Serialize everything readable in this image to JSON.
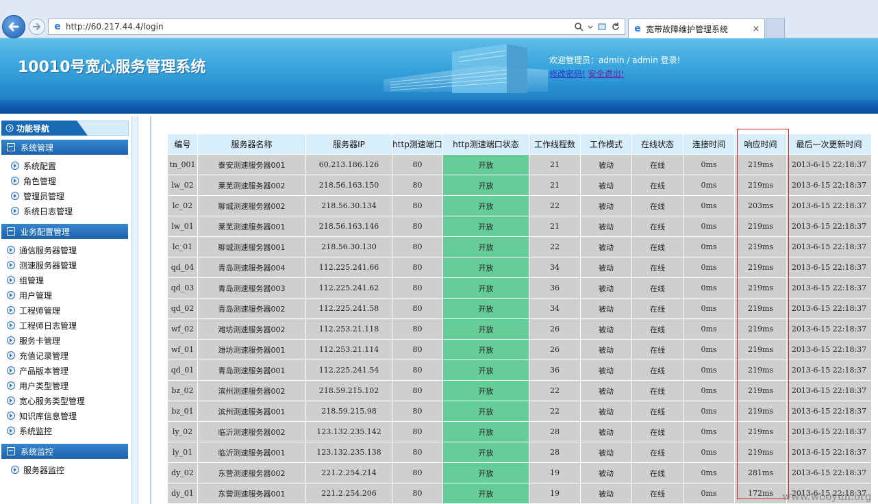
{
  "browser": {
    "url": "http://60.217.44.4/login",
    "tab_title": "宽带故障维护管理系统",
    "tab_close": "×",
    "icons": [
      "back-icon",
      "forward-icon",
      "ie-icon",
      "search-icon",
      "dropdown-icon",
      "compat-icon",
      "refresh-icon",
      "close-icon"
    ]
  },
  "header": {
    "site_title": "10010号宽心服务管理系统",
    "welcome_text": "欢迎管理员：admin / admin 登录!",
    "change_password": "修改密码!",
    "logout": "安全退出!"
  },
  "sidebar": {
    "nav_title": "功能导航",
    "sections": [
      {
        "label": "系统管理",
        "items": [
          "系统配置",
          "角色管理",
          "管理员管理",
          "系统日志管理"
        ]
      },
      {
        "label": "业务配置管理",
        "items": [
          "通信服务器管理",
          "测速服务器管理",
          "组管理",
          "用户管理",
          "工程师管理",
          "工程师日志管理",
          "服务卡管理",
          "充值记录管理",
          "产品版本管理",
          "用户类型管理",
          "宽心服务类型管理",
          "知识库信息管理",
          "系统监控"
        ]
      },
      {
        "label": "系统监控",
        "items": [
          "服务器监控"
        ]
      }
    ]
  },
  "table": {
    "columns": [
      "编号",
      "服务器名称",
      "服务器IP",
      "http测速端口",
      "http测速端口状态",
      "工作线程数",
      "工作模式",
      "在线状态",
      "连接时间",
      "响应时间",
      "最后一次更新时间"
    ],
    "rows": [
      [
        "tn_001",
        "泰安测速服务器001",
        "60.213.186.126",
        "80",
        "开放",
        "21",
        "被动",
        "在线",
        "0ms",
        "219ms",
        "2013-6-15 22:18:37"
      ],
      [
        "lw_02",
        "莱芜测速服务器002",
        "218.56.163.150",
        "80",
        "开放",
        "21",
        "被动",
        "在线",
        "0ms",
        "219ms",
        "2013-6-15 22:18:37"
      ],
      [
        "lc_02",
        "聊城测速服务器002",
        "218.56.30.134",
        "80",
        "开放",
        "22",
        "被动",
        "在线",
        "0ms",
        "203ms",
        "2013-6-15 22:18:37"
      ],
      [
        "lw_01",
        "莱芜测速服务器001",
        "218.56.163.146",
        "80",
        "开放",
        "21",
        "被动",
        "在线",
        "0ms",
        "219ms",
        "2013-6-15 22:18:37"
      ],
      [
        "lc_01",
        "聊城测速服务器001",
        "218.56.30.130",
        "80",
        "开放",
        "22",
        "被动",
        "在线",
        "0ms",
        "219ms",
        "2013-6-15 22:18:37"
      ],
      [
        "qd_04",
        "青岛测速服务器004",
        "112.225.241.66",
        "80",
        "开放",
        "34",
        "被动",
        "在线",
        "0ms",
        "219ms",
        "2013-6-15 22:18:37"
      ],
      [
        "qd_03",
        "青岛测速服务器003",
        "112.225.241.62",
        "80",
        "开放",
        "36",
        "被动",
        "在线",
        "0ms",
        "219ms",
        "2013-6-15 22:18:37"
      ],
      [
        "qd_02",
        "青岛测速服务器002",
        "112.225.241.58",
        "80",
        "开放",
        "34",
        "被动",
        "在线",
        "0ms",
        "219ms",
        "2013-6-15 22:18:37"
      ],
      [
        "wf_02",
        "潍坊测速服务器002",
        "112.253.21.118",
        "80",
        "开放",
        "26",
        "被动",
        "在线",
        "0ms",
        "219ms",
        "2013-6-15 22:18:37"
      ],
      [
        "wf_01",
        "潍坊测速服务器001",
        "112.253.21.114",
        "80",
        "开放",
        "26",
        "被动",
        "在线",
        "0ms",
        "219ms",
        "2013-6-15 22:18:37"
      ],
      [
        "qd_01",
        "青岛测速服务器001",
        "112.225.241.54",
        "80",
        "开放",
        "36",
        "被动",
        "在线",
        "0ms",
        "219ms",
        "2013-6-15 22:18:37"
      ],
      [
        "bz_02",
        "滨州测速服务器002",
        "218.59.215.102",
        "80",
        "开放",
        "22",
        "被动",
        "在线",
        "0ms",
        "219ms",
        "2013-6-15 22:18:37"
      ],
      [
        "bz_01",
        "滨州测速服务器001",
        "218.59.215.98",
        "80",
        "开放",
        "22",
        "被动",
        "在线",
        "0ms",
        "219ms",
        "2013-6-15 22:18:37"
      ],
      [
        "ly_02",
        "临沂测速服务器002",
        "123.132.235.142",
        "80",
        "开放",
        "28",
        "被动",
        "在线",
        "0ms",
        "219ms",
        "2013-6-15 22:18:37"
      ],
      [
        "ly_01",
        "临沂测速服务器001",
        "123.132.235.138",
        "80",
        "开放",
        "28",
        "被动",
        "在线",
        "0ms",
        "219ms",
        "2013-6-15 22:18:37"
      ],
      [
        "dy_02",
        "东营测速服务器002",
        "221.2.254.214",
        "80",
        "开放",
        "19",
        "被动",
        "在线",
        "0ms",
        "281ms",
        "2013-6-15 22:18:37"
      ],
      [
        "dy_01",
        "东营测速服务器001",
        "221.2.254.206",
        "80",
        "开放",
        "19",
        "被动",
        "在线",
        "0ms",
        "172ms",
        "2013-6-15 22:18:37"
      ]
    ]
  },
  "watermark": "www.wooyun.org",
  "colors": {
    "header_blue": "#3aa5dd",
    "stripe_blue": "#0e58ad",
    "table_header": "#d9eefb",
    "table_cell": "#cfcfcf",
    "status_green": "#66cc99",
    "highlight_red": "#d21f1f"
  }
}
